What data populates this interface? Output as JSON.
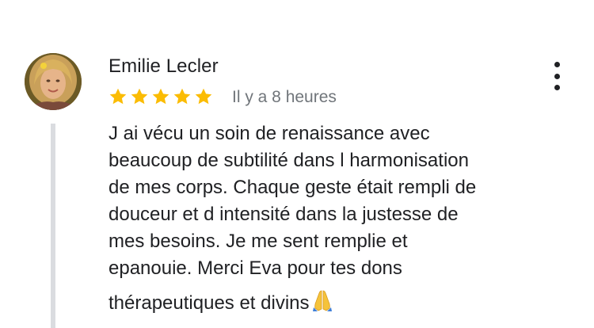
{
  "review": {
    "author_name": "Emilie Lecler",
    "rating": 5,
    "rating_max": 5,
    "time_ago": "Il y a 8 heures",
    "text_lines": [
      "J ai vécu un soin de renaissance avec",
      "beaucoup de subtilité dans l harmonisation",
      "de mes corps. Chaque geste était rempli de",
      "douceur et d intensité dans la justesse de",
      "mes besoins. Je me sent remplie et",
      "epanouie. Merci Eva pour tes dons",
      "thérapeutiques et divins"
    ],
    "emoji_icon": "folded-hands-icon"
  },
  "icons": {
    "menu": "more-vertical-icon",
    "star": "star-icon"
  },
  "colors": {
    "star": "#fbbc04",
    "time_text": "#70757a",
    "quote_bar": "#dadce0"
  }
}
